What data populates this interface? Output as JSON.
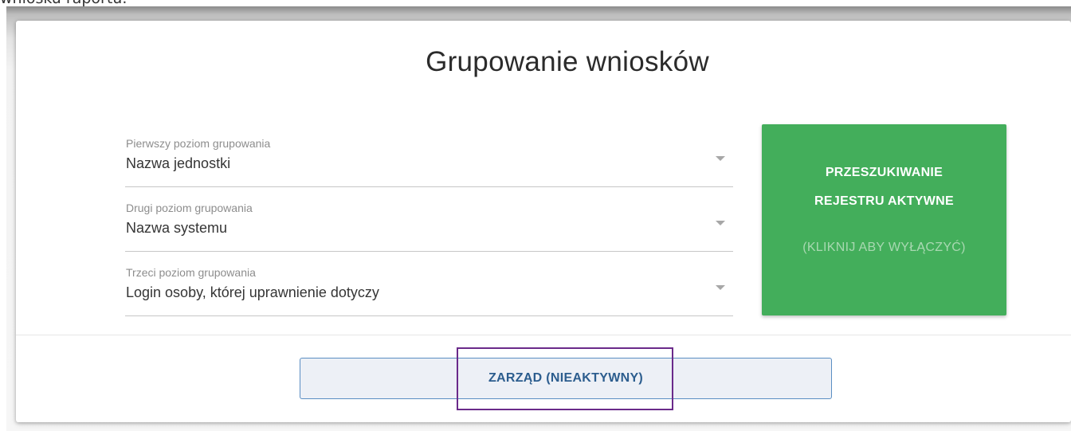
{
  "caption": "wniosku raportu.",
  "title": "Grupowanie wniosków",
  "selects": [
    {
      "label": "Pierwszy poziom grupowania",
      "value": "Nazwa jednostki"
    },
    {
      "label": "Drugi poziom grupowania",
      "value": "Nazwa systemu"
    },
    {
      "label": "Trzeci poziom grupowania",
      "value": "Login osoby, której uprawnienie dotyczy"
    }
  ],
  "registry_button": {
    "line1": "PRZESZUKIWANIE",
    "line2": "REJESTRU AKTYWNE",
    "line3": "(KLIKNIJ ABY WYŁĄCZYĆ)",
    "color": "#43ae5b"
  },
  "board_button": {
    "label": "ZARZĄD (NIEAKTYWNY)"
  },
  "icons": {
    "select_caret": "chevron-down-icon"
  },
  "colors": {
    "highlight": "#6a2a8a",
    "board_border": "#5a8ec3"
  }
}
